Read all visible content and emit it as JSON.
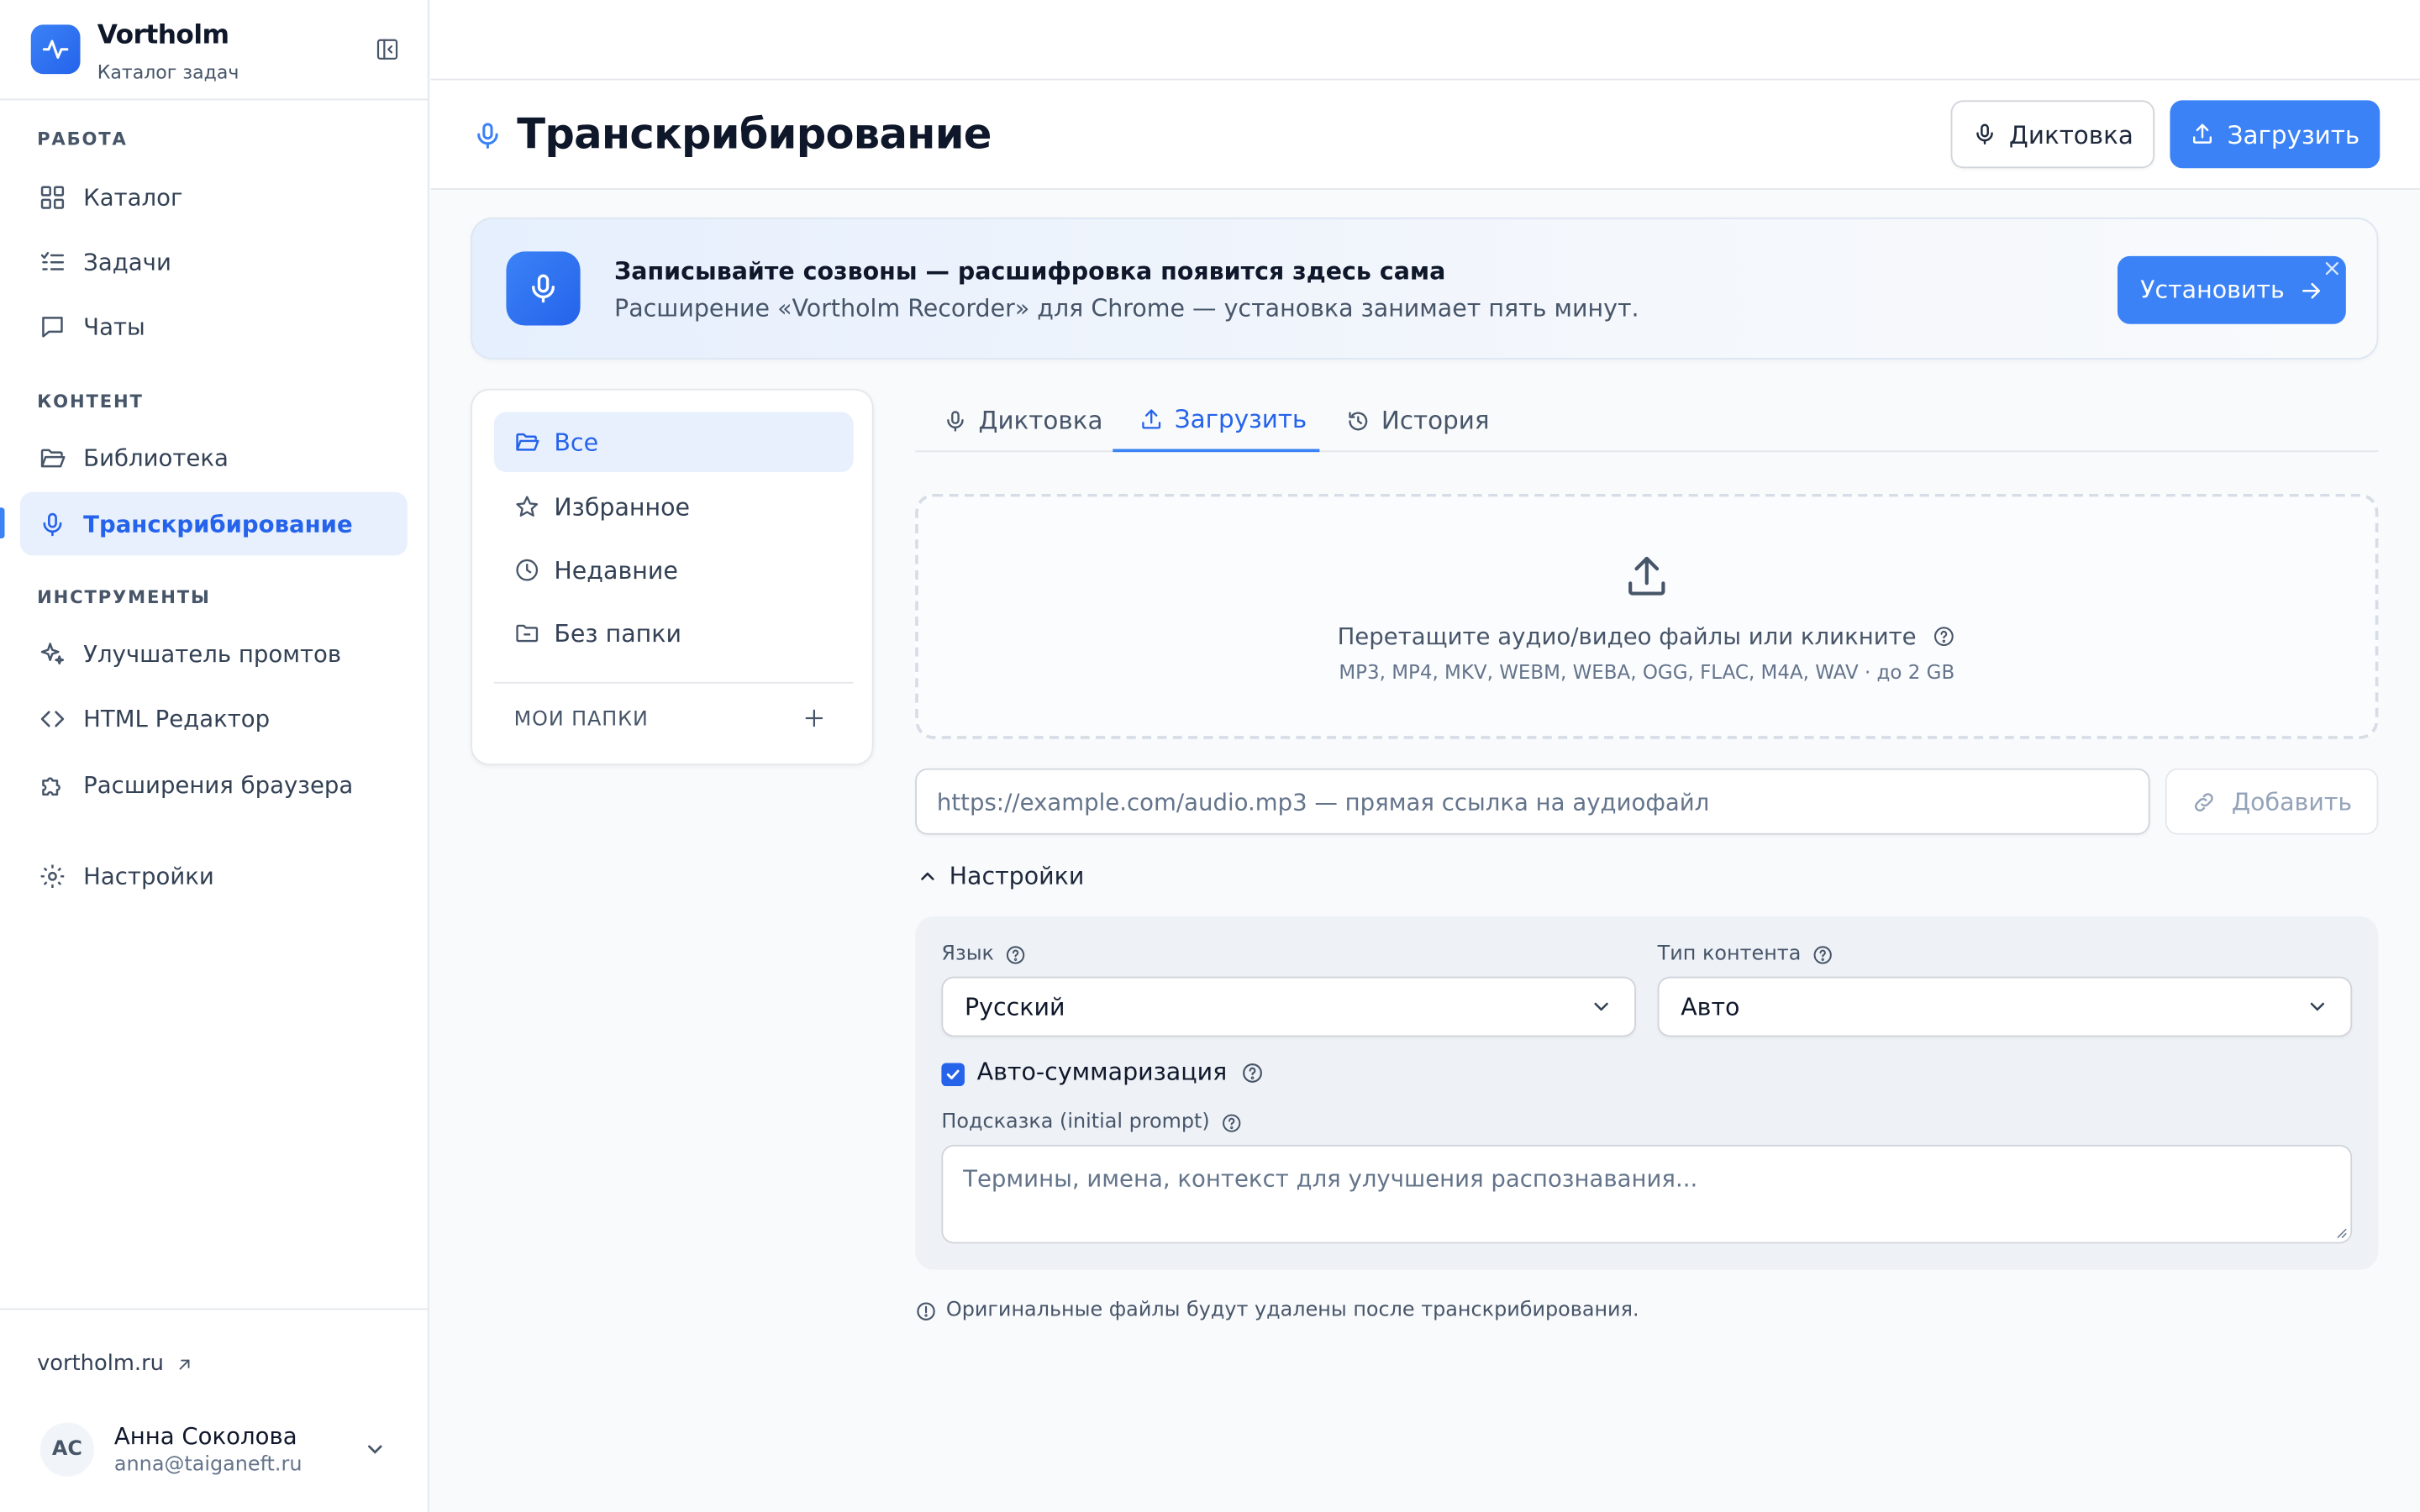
{
  "app": {
    "name": "Vortholm",
    "subtitle": "Каталог задач"
  },
  "sidebar": {
    "sections": [
      {
        "title": "РАБОТА"
      },
      {
        "title": "КОНТЕНТ"
      },
      {
        "title": "ИНСТРУМЕНТЫ"
      }
    ],
    "items": [
      {
        "label": "Каталог",
        "icon": "grid-icon"
      },
      {
        "label": "Задачи",
        "icon": "list-check-icon"
      },
      {
        "label": "Чаты",
        "icon": "chat-icon"
      },
      {
        "label": "Библиотека",
        "icon": "folder-open-icon"
      },
      {
        "label": "Транскрибирование",
        "icon": "mic-icon",
        "active": true
      },
      {
        "label": "Улучшатель промтов",
        "icon": "sparkles-icon"
      },
      {
        "label": "HTML Редактор",
        "icon": "code-icon"
      },
      {
        "label": "Расширения браузера",
        "icon": "puzzle-icon"
      },
      {
        "label": "Настройки",
        "icon": "gear-icon"
      }
    ],
    "site_link": "vortholm.ru",
    "user": {
      "initials": "АС",
      "name": "Анна Соколова",
      "email": "anna@taiganeft.ru"
    }
  },
  "header": {
    "title": "Транскрибирование",
    "dictation_button": "Диктовка",
    "upload_button": "Загрузить"
  },
  "banner": {
    "title": "Записывайте созвоны — расшифровка появится здесь сама",
    "subtitle": "Расширение «Vortholm Recorder» для Chrome — установка занимает пять минут.",
    "button": "Установить"
  },
  "folders": {
    "items": [
      {
        "label": "Все",
        "icon": "folder-open-icon",
        "active": true
      },
      {
        "label": "Избранное",
        "icon": "star-icon"
      },
      {
        "label": "Недавние",
        "icon": "clock-icon"
      },
      {
        "label": "Без папки",
        "icon": "folder-minus-icon"
      }
    ],
    "my_folders": "МОИ ПАПКИ"
  },
  "tabs": [
    {
      "label": "Диктовка",
      "icon": "mic-icon"
    },
    {
      "label": "Загрузить",
      "icon": "upload-icon",
      "active": true
    },
    {
      "label": "История",
      "icon": "history-icon"
    }
  ],
  "dropzone": {
    "text": "Перетащите аудио/видео файлы или кликните",
    "formats": "MP3, MP4, MKV, WEBM, WEBA, OGG, FLAC, M4A, WAV · до 2 GB"
  },
  "url": {
    "placeholder": "https://example.com/audio.mp3 — прямая ссылка на аудиофайл",
    "add_button": "Добавить"
  },
  "settings": {
    "toggle_label": "Настройки",
    "language_label": "Язык",
    "language_value": "Русский",
    "content_type_label": "Тип контента",
    "content_type_value": "Авто",
    "auto_summary_label": "Авто-суммаризация",
    "auto_summary_checked": true,
    "prompt_label": "Подсказка (initial prompt)",
    "prompt_placeholder": "Термины, имена, контекст для улучшения распознавания..."
  },
  "note": "Оригинальные файлы будут удалены после транскрибирования.",
  "colors": {
    "accent": "#3b82f6",
    "accent_dark": "#2563eb",
    "active_bg": "#e8f0fd"
  }
}
